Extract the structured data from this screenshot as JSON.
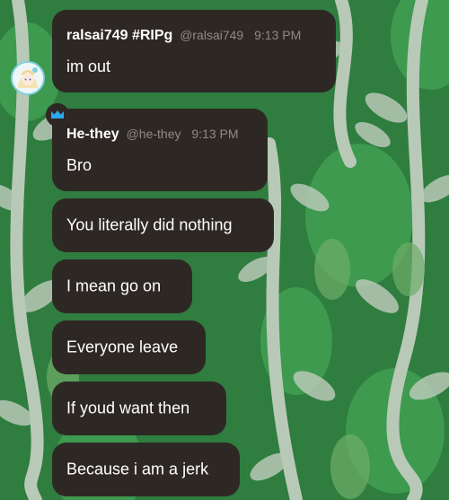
{
  "messages": [
    {
      "username": "ralsai749 #RIPg",
      "handle": "@ralsai749",
      "time": "9:13 PM",
      "text": "im out"
    },
    {
      "username": "He-they",
      "handle": "@he-they",
      "time": "9:13 PM",
      "text": "Bro"
    }
  ],
  "followups": [
    {
      "text": "You literally did nothing"
    },
    {
      "text": "I  mean go on"
    },
    {
      "text": "Everyone leave"
    },
    {
      "text": "If youd want then"
    },
    {
      "text": "Because i am a jerk"
    }
  ],
  "icons": {
    "avatar": "anime-girl-avatar",
    "badge": "crown-icon"
  },
  "colors": {
    "bubble": "#2e2825",
    "meta_text": "#8f8a86",
    "background": "#2f7d3f",
    "leaf": "#b9c9b8",
    "crown": "#2aa8f0"
  }
}
